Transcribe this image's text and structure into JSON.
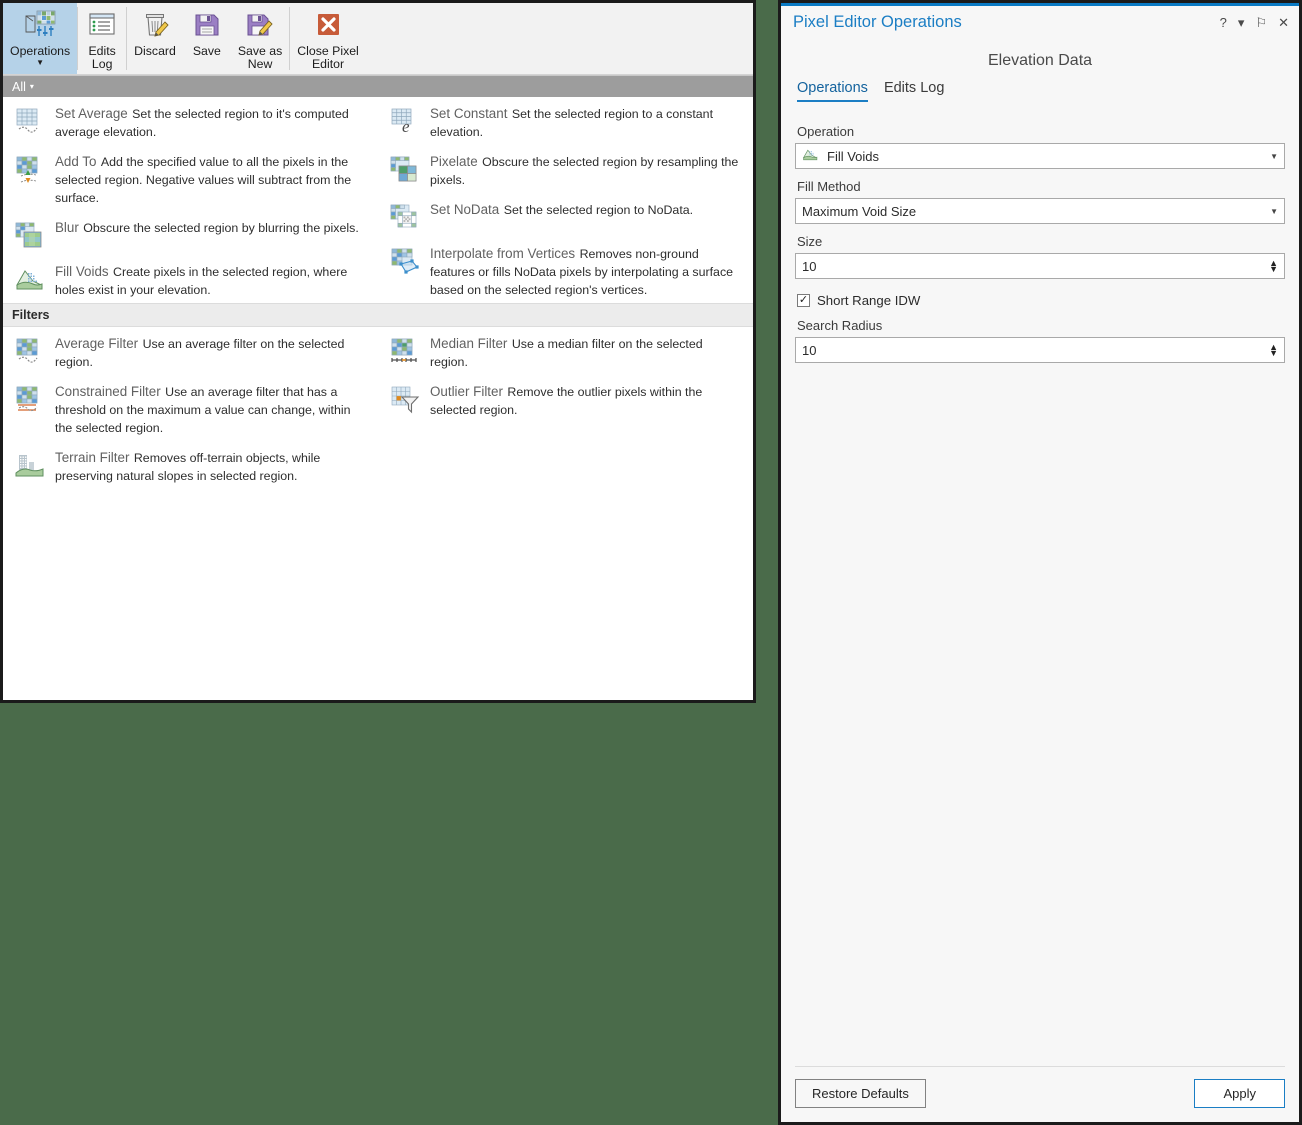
{
  "ribbon": {
    "buttons": [
      {
        "label": "Operations",
        "icon": "operations-grid-icon",
        "selected": true,
        "has_caret": true
      },
      {
        "label": "Edits\nLog",
        "icon": "edits-log-icon",
        "selected": false,
        "has_caret": false
      },
      {
        "label": "Discard",
        "icon": "discard-trash-icon",
        "selected": false,
        "has_caret": false
      },
      {
        "label": "Save",
        "icon": "save-floppy-icon",
        "selected": false,
        "has_caret": false
      },
      {
        "label": "Save as\nNew",
        "icon": "save-as-new-icon",
        "selected": false,
        "has_caret": false
      },
      {
        "label": "Close Pixel\nEditor",
        "icon": "close-x-icon",
        "selected": false,
        "has_caret": false
      }
    ]
  },
  "filter_bar": {
    "label": "All",
    "caret": "▾"
  },
  "gallery": {
    "operations": [
      {
        "title": "Set Average",
        "desc": "Set the selected region to it's computed average elevation.",
        "icon": "set-average-icon"
      },
      {
        "title": "Set Constant",
        "desc": "Set the selected region to a constant elevation.",
        "icon": "set-constant-icon"
      },
      {
        "title": "Add To",
        "desc": "Add the specified value to all the pixels in the selected region. Negative values will subtract from the surface.",
        "icon": "add-to-icon"
      },
      {
        "title": "Pixelate",
        "desc": "Obscure the selected region by resampling the pixels.",
        "icon": "pixelate-icon"
      },
      {
        "title": "Blur",
        "desc": "Obscure the selected region by blurring the pixels.",
        "icon": "blur-icon"
      },
      {
        "title": "Set NoData",
        "desc": "Set the selected region to NoData.",
        "icon": "set-nodata-icon"
      },
      {
        "title": "Fill Voids",
        "desc": "Create pixels in the selected region, where holes exist in your elevation.",
        "icon": "fill-voids-icon"
      },
      {
        "title": "Interpolate from Vertices",
        "desc": "Removes non-ground features or fills NoData pixels by interpolating a surface based on the selected region's vertices.",
        "icon": "interpolate-from-vertices-icon"
      }
    ],
    "filters_group_label": "Filters",
    "filters": [
      {
        "title": "Average Filter",
        "desc": "Use an average filter on the selected region.",
        "icon": "average-filter-icon"
      },
      {
        "title": "Median Filter",
        "desc": "Use a median filter on the selected region.",
        "icon": "median-filter-icon"
      },
      {
        "title": "Constrained Filter",
        "desc": "Use an average filter that has a threshold on the maximum a value can change, within the selected region.",
        "icon": "constrained-filter-icon"
      },
      {
        "title": "Outlier Filter",
        "desc": "Remove the outlier pixels within the selected region.",
        "icon": "outlier-filter-icon"
      },
      {
        "title": "Terrain Filter",
        "desc": "Removes off-terrain objects, while preserving natural slopes in selected region.",
        "icon": "terrain-filter-icon"
      }
    ]
  },
  "pane": {
    "title": "Pixel Editor Operations",
    "title_tools": [
      {
        "glyph": "?",
        "name": "help-icon"
      },
      {
        "glyph": "▾",
        "name": "menu-caret-icon"
      },
      {
        "glyph": "⚐",
        "name": "pin-icon"
      },
      {
        "glyph": "✕",
        "name": "close-icon"
      }
    ],
    "heading": "Elevation Data",
    "tabs": [
      {
        "label": "Operations",
        "active": true
      },
      {
        "label": "Edits Log",
        "active": false
      }
    ],
    "fields": {
      "operation_label": "Operation",
      "operation_value": "Fill Voids",
      "operation_icon": "fill-voids-icon",
      "fill_method_label": "Fill Method",
      "fill_method_value": "Maximum Void Size",
      "size_label": "Size",
      "size_value": "10",
      "short_range_idw_label": "Short Range IDW",
      "short_range_idw_checked": true,
      "search_radius_label": "Search Radius",
      "search_radius_value": "10"
    },
    "footer": {
      "restore_defaults": "Restore Defaults",
      "apply": "Apply"
    }
  },
  "colors": {
    "accent_blue": "#1b7ec4",
    "selected_ribbon": "#b5d2e8",
    "filter_bar": "#9d9d9d",
    "desktop_green": "#4a6b4a",
    "close_orange": "#c75b39"
  }
}
